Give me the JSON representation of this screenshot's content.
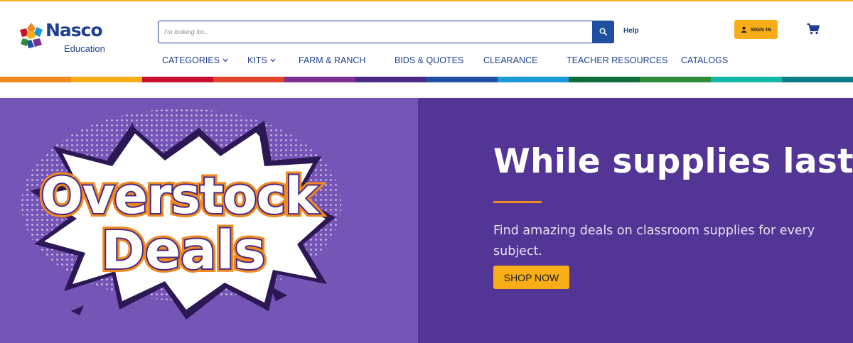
{
  "brand": {
    "name": "Nasco",
    "sub": "Education"
  },
  "search": {
    "placeholder": "I'm looking for..."
  },
  "header": {
    "help_label": "Help",
    "sign_in_label": "SIGN IN"
  },
  "nav": {
    "items": [
      {
        "label": "CATEGORIES",
        "has_dropdown": true
      },
      {
        "label": "KITS",
        "has_dropdown": true
      },
      {
        "label": "FARM & RANCH",
        "has_dropdown": false
      },
      {
        "label": "BIDS & QUOTES",
        "has_dropdown": false
      },
      {
        "label": "CLEARANCE",
        "has_dropdown": false
      },
      {
        "label": "TEACHER RESOURCES",
        "has_dropdown": false
      },
      {
        "label": "CATALOGS",
        "has_dropdown": false
      }
    ]
  },
  "rainbow_colors": [
    "#f18a1d",
    "#f9ad19",
    "#c8102e",
    "#e0452a",
    "#7d2f8e",
    "#4b2a85",
    "#1f4fa0",
    "#1a9ad6",
    "#0b6b3a",
    "#2e8b3a",
    "#12b8a6",
    "#0d7c8a"
  ],
  "hero": {
    "graphic_text": [
      "Overstock",
      "Deals"
    ],
    "headline": "While supplies last!",
    "subtext": "Find amazing deals on classroom supplies for every subject.",
    "cta_label": "SHOP NOW"
  },
  "colors": {
    "brand_blue": "#1f3f8f",
    "accent_yellow": "#f9ad19",
    "hero_left_bg": "#7555b6",
    "hero_right_bg": "#523594",
    "divider_orange": "#f18a1d"
  },
  "icons": {
    "logo": "nasco-flower-logo-icon",
    "search": "search-icon",
    "user": "user-icon",
    "cart": "cart-icon",
    "chevron": "chevron-down-icon"
  }
}
